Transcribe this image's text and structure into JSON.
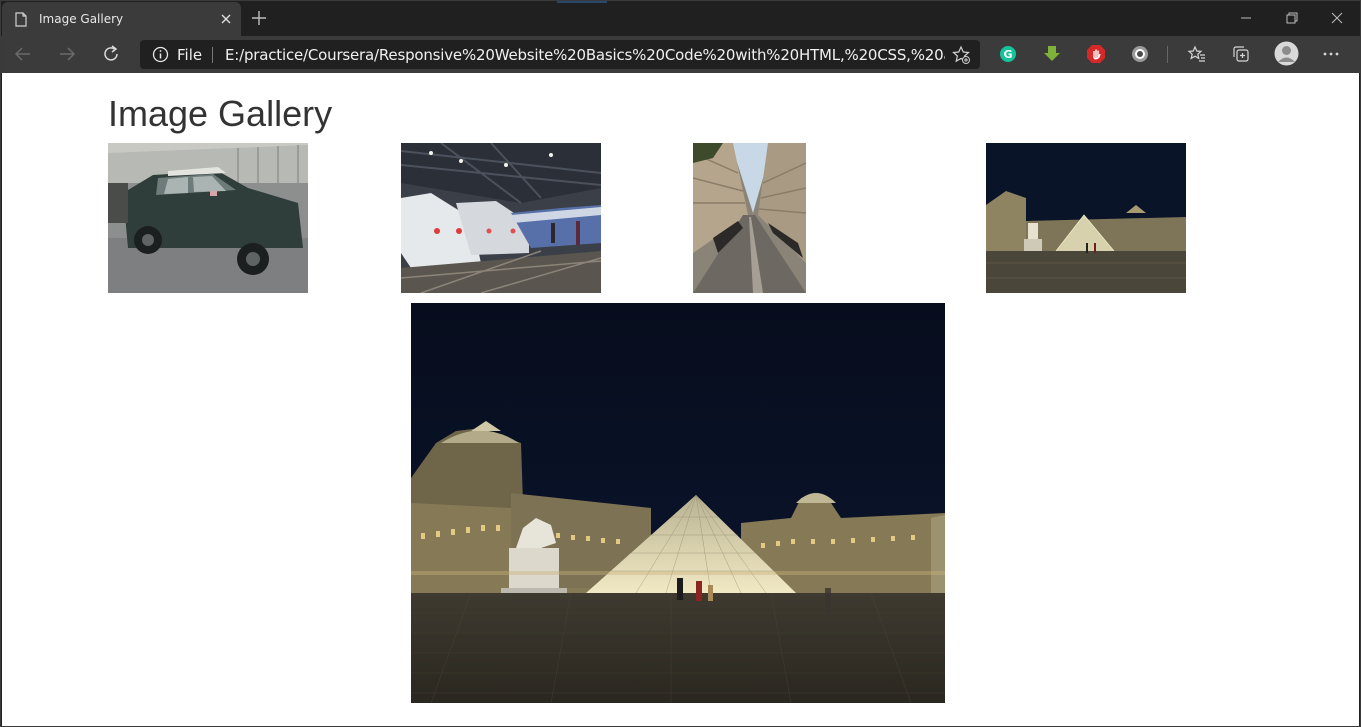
{
  "browser": {
    "tab": {
      "title": "Image Gallery",
      "icon": "page-icon"
    },
    "address_bar": {
      "scheme_label": "File",
      "url": "E:/practice/Coursera/Responsive%20Website%20Basics%20Code%20with%20HTML,%20CSS,%20an..."
    },
    "extensions": [
      "grammarly-icon",
      "download-arrow-icon",
      "hand-stop-icon",
      "record-circle-icon"
    ],
    "toolbar_icons": [
      "favorites-icon",
      "collections-icon",
      "profile-avatar",
      "more-menu-icon"
    ]
  },
  "page": {
    "title": "Image Gallery",
    "thumbnails": [
      {
        "subject": "mini-car-photo"
      },
      {
        "subject": "tgv-trains-station-photo"
      },
      {
        "subject": "paris-street-photo"
      },
      {
        "subject": "louvre-pyramid-night-photo"
      }
    ],
    "featured": {
      "subject": "louvre-pyramid-night-photo"
    }
  },
  "colors": {
    "tab_active": "#3b3b3b",
    "titlebar": "#202020",
    "page_bg": "#ffffff",
    "heading_text": "#333333",
    "grammarly": "#15c39a",
    "download_ext": "#7fb23a",
    "stop_ext": "#d62828"
  }
}
